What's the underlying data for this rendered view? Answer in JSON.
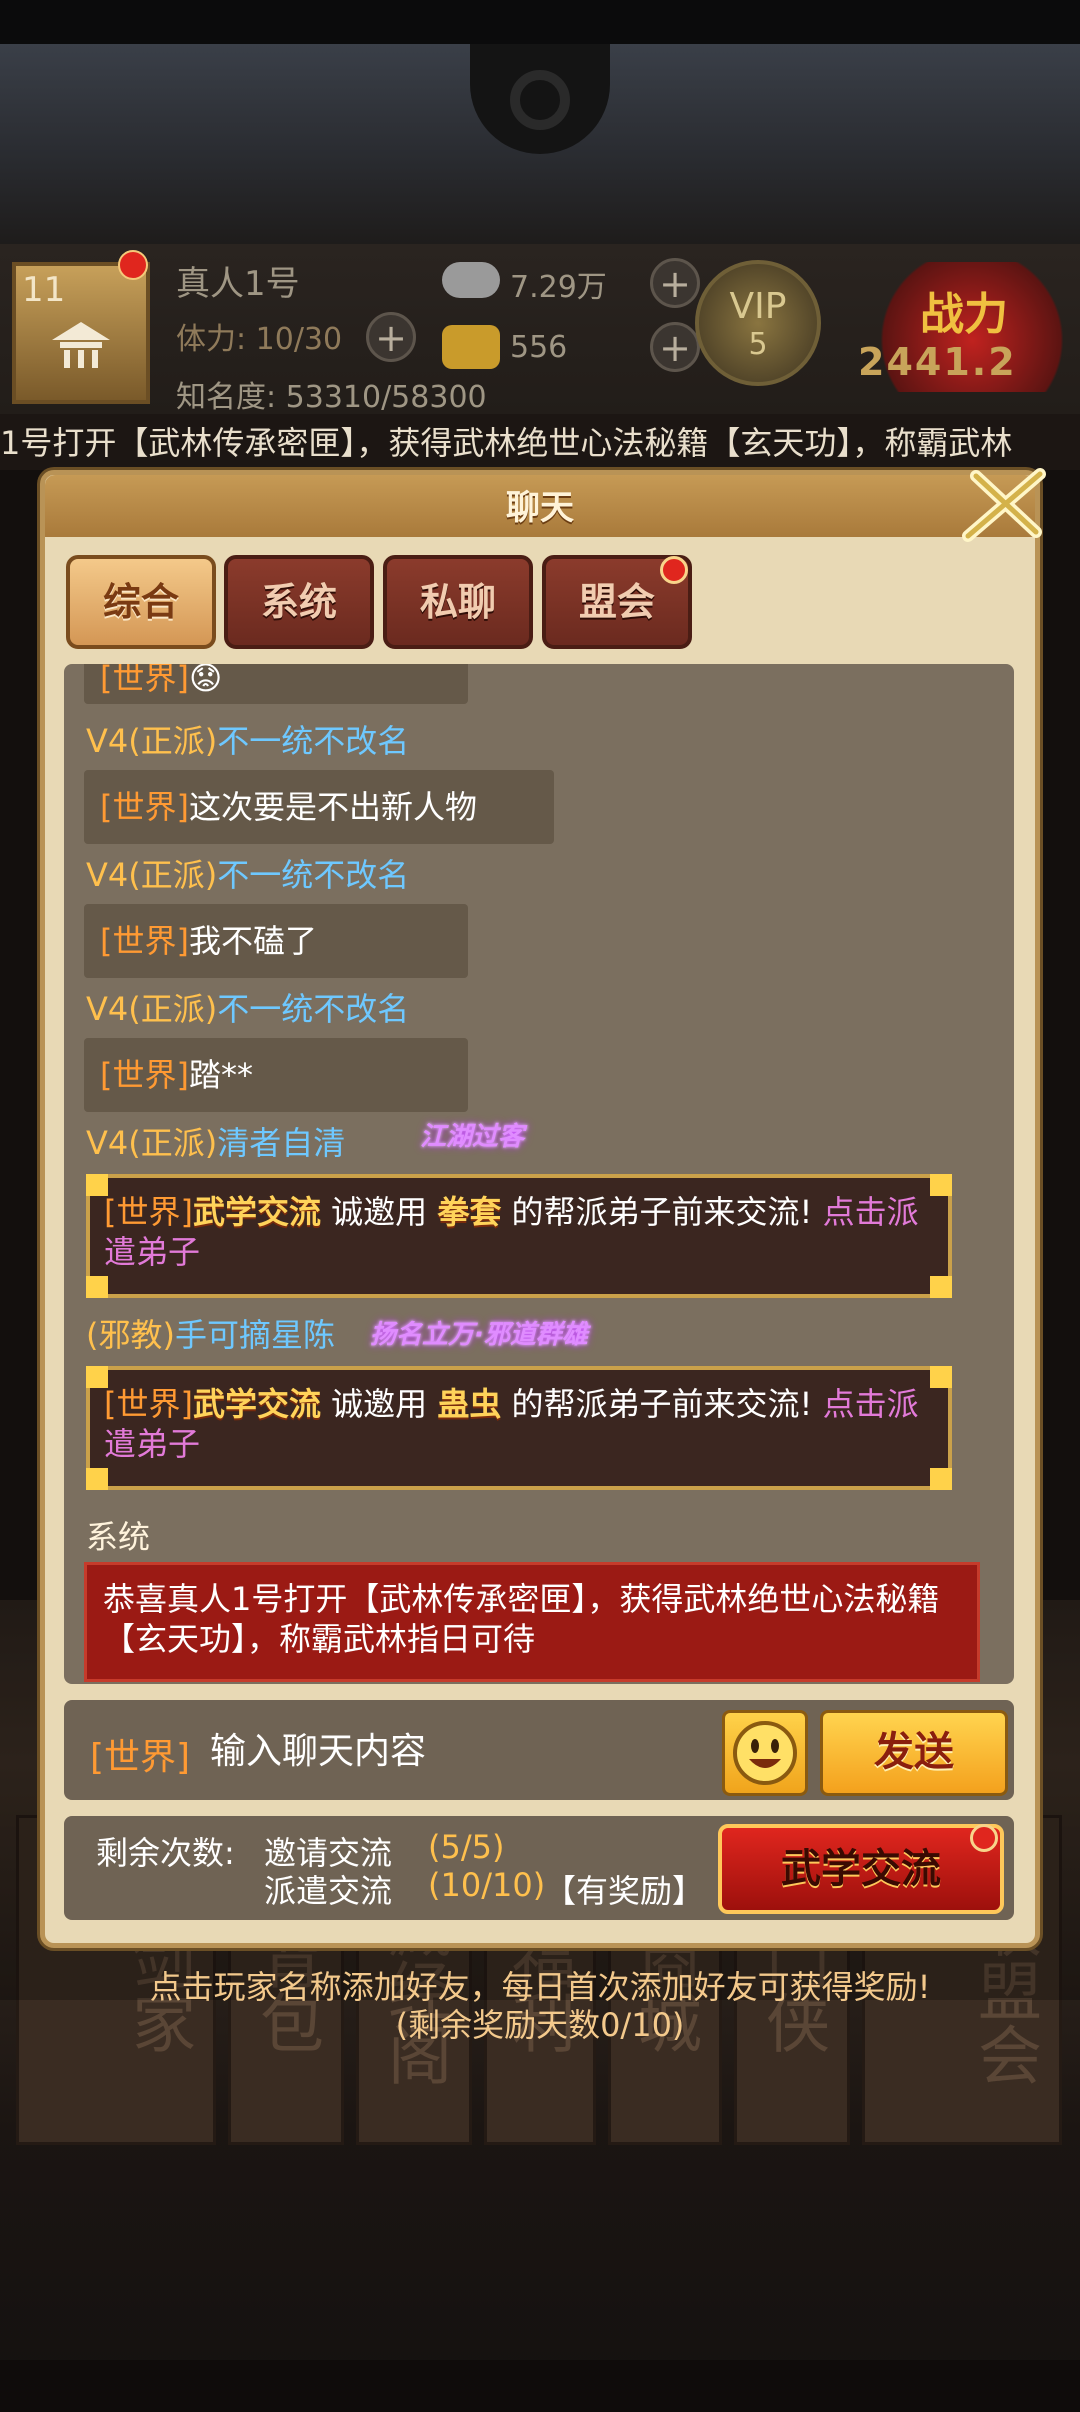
{
  "hud": {
    "level": "11",
    "player_name": "真人1号",
    "stamina": "体力: 10/30",
    "fame": "知名度: 53310/58300",
    "silver": "7.29万",
    "gold": "556",
    "vip_label": "VIP",
    "vip_level": "5",
    "power_label": "战力",
    "power_value": "2441.2"
  },
  "marquee": "1号打开【武林传承密匣】，获得武林绝世心法秘籍【玄天功】，称霸武林",
  "chat": {
    "title": "聊天",
    "tabs": [
      {
        "label": "综合",
        "active": true
      },
      {
        "label": "系统"
      },
      {
        "label": "私聊"
      },
      {
        "label": "盟会"
      }
    ],
    "messages": {
      "m0": {
        "tag": "[世界]",
        "text": "😟"
      },
      "s1": {
        "prefix": "V4(正派)",
        "name": "不一统不改名"
      },
      "m1": {
        "tag": "[世界]",
        "text": "这次要是不出新人物"
      },
      "s2": {
        "prefix": "V4(正派)",
        "name": "不一统不改名"
      },
      "m2": {
        "tag": "[世界]",
        "text": "我不磕了"
      },
      "s3": {
        "prefix": "V4(正派)",
        "name": "不一统不改名"
      },
      "m3": {
        "tag": "[世界]",
        "text": "踏**"
      },
      "s4": {
        "prefix": "V4(正派)",
        "name": "清者自清",
        "badge": "江湖过客"
      },
      "e1": {
        "tag": "[世界]",
        "event": "武学交流",
        "pre": " 诚邀用 ",
        "item": "拳套",
        "post": " 的帮派弟子前来交流! ",
        "link": "点击派遣弟子"
      },
      "s5": {
        "prefix": "(邪教)",
        "name": "手可摘星陈",
        "badge": "扬名立万·邪道群雄"
      },
      "e2": {
        "tag": "[世界]",
        "event": "武学交流",
        "pre": " 诚邀用 ",
        "item": "蛊虫",
        "post": " 的帮派弟子前来交流! ",
        "link": "点击派遣弟子"
      },
      "sys_label": "系统",
      "sys_text": "恭喜真人1号打开【武林传承密匣】，获得武林绝世心法秘籍【玄天功】，称霸武林指日可待"
    },
    "input": {
      "tag": "[世界]",
      "placeholder": "输入聊天内容"
    },
    "send_label": "发送",
    "stats": {
      "remaining_label": "剩余次数:",
      "invite_label": "邀请交流",
      "invite_value": "(5/5)",
      "dispatch_label": "派遣交流",
      "dispatch_value": "(10/10)",
      "reward_note": "【有奖励】"
    },
    "exchange_button": "武学交流"
  },
  "friend_hint": {
    "line1": "点击玩家名称添加好友，每日首次添加好友可获得奖励!",
    "line2": "(剩余奖励天数0/10)"
  },
  "bg_tiles": [
    "剑家",
    "背包",
    "藏经阁",
    "福利",
    "商城",
    "门侠",
    "联盟会"
  ],
  "colors": {
    "accent_gold": "#ffc04d",
    "system_red": "#9b1a14",
    "name_blue": "#6ec8ff"
  }
}
